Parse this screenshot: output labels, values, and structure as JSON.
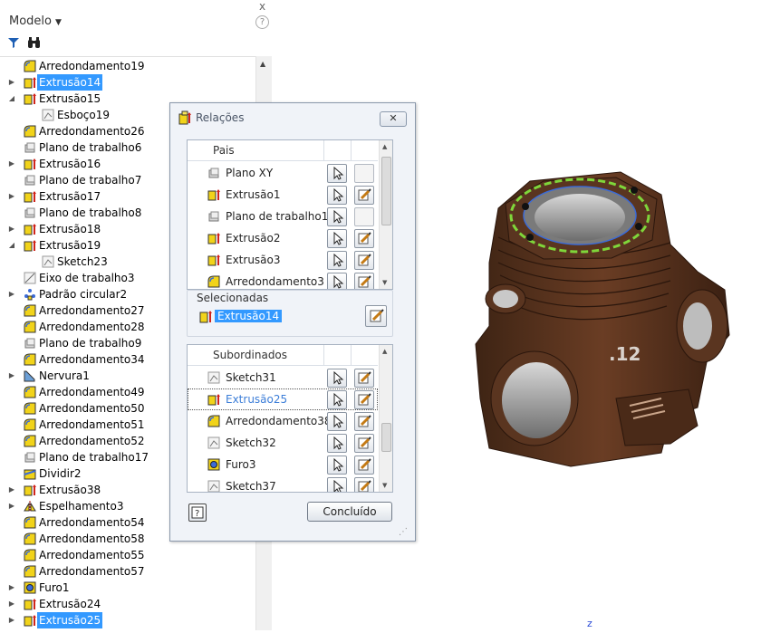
{
  "browser": {
    "title": "Modelo",
    "help": "?",
    "close": "x",
    "tree": [
      {
        "label": "Arredondamento19",
        "icon": "fillet-icon",
        "expand": "",
        "indent": 0,
        "selected": false
      },
      {
        "label": "Extrusão14",
        "icon": "extrusion-icon",
        "expand": "▶",
        "indent": 0,
        "selected": true
      },
      {
        "label": "Extrusão15",
        "icon": "extrusion-icon",
        "expand": "◢",
        "indent": 0,
        "selected": false
      },
      {
        "label": "Esboço19",
        "icon": "sketch-icon",
        "expand": "",
        "indent": 1,
        "selected": false
      },
      {
        "label": "Arredondamento26",
        "icon": "fillet-icon",
        "expand": "",
        "indent": 0,
        "selected": false
      },
      {
        "label": "Plano de trabalho6",
        "icon": "workplane-icon",
        "expand": "",
        "indent": 0,
        "selected": false
      },
      {
        "label": "Extrusão16",
        "icon": "extrusion-icon",
        "expand": "▶",
        "indent": 0,
        "selected": false
      },
      {
        "label": "Plano de trabalho7",
        "icon": "workplane-icon",
        "expand": "",
        "indent": 0,
        "selected": false
      },
      {
        "label": "Extrusão17",
        "icon": "extrusion-icon",
        "expand": "▶",
        "indent": 0,
        "selected": false
      },
      {
        "label": "Plano de trabalho8",
        "icon": "workplane-icon",
        "expand": "",
        "indent": 0,
        "selected": false
      },
      {
        "label": "Extrusão18",
        "icon": "extrusion-icon",
        "expand": "▶",
        "indent": 0,
        "selected": false
      },
      {
        "label": "Extrusão19",
        "icon": "extrusion-icon",
        "expand": "◢",
        "indent": 0,
        "selected": false
      },
      {
        "label": "Sketch23",
        "icon": "sketch-icon",
        "expand": "",
        "indent": 1,
        "selected": false
      },
      {
        "label": "Eixo de trabalho3",
        "icon": "workaxis-icon",
        "expand": "",
        "indent": 0,
        "selected": false
      },
      {
        "label": "Padrão circular2",
        "icon": "circular-pattern-icon",
        "expand": "▶",
        "indent": 0,
        "selected": false
      },
      {
        "label": "Arredondamento27",
        "icon": "fillet-icon",
        "expand": "",
        "indent": 0,
        "selected": false
      },
      {
        "label": "Arredondamento28",
        "icon": "fillet-icon",
        "expand": "",
        "indent": 0,
        "selected": false
      },
      {
        "label": "Plano de trabalho9",
        "icon": "workplane-icon",
        "expand": "",
        "indent": 0,
        "selected": false
      },
      {
        "label": "Arredondamento34",
        "icon": "fillet-icon",
        "expand": "",
        "indent": 0,
        "selected": false
      },
      {
        "label": "Nervura1",
        "icon": "rib-icon",
        "expand": "▶",
        "indent": 0,
        "selected": false
      },
      {
        "label": "Arredondamento49",
        "icon": "fillet-icon",
        "expand": "",
        "indent": 0,
        "selected": false
      },
      {
        "label": "Arredondamento50",
        "icon": "fillet-icon",
        "expand": "",
        "indent": 0,
        "selected": false
      },
      {
        "label": "Arredondamento51",
        "icon": "fillet-icon",
        "expand": "",
        "indent": 0,
        "selected": false
      },
      {
        "label": "Arredondamento52",
        "icon": "fillet-icon",
        "expand": "",
        "indent": 0,
        "selected": false
      },
      {
        "label": "Plano de trabalho17",
        "icon": "workplane-icon",
        "expand": "",
        "indent": 0,
        "selected": false
      },
      {
        "label": "Dividir2",
        "icon": "split-icon",
        "expand": "",
        "indent": 0,
        "selected": false
      },
      {
        "label": "Extrusão38",
        "icon": "extrusion-icon",
        "expand": "▶",
        "indent": 0,
        "selected": false
      },
      {
        "label": "Espelhamento3",
        "icon": "mirror-icon",
        "expand": "▶",
        "indent": 0,
        "selected": false
      },
      {
        "label": "Arredondamento54",
        "icon": "fillet-icon",
        "expand": "",
        "indent": 0,
        "selected": false
      },
      {
        "label": "Arredondamento58",
        "icon": "fillet-icon",
        "expand": "",
        "indent": 0,
        "selected": false
      },
      {
        "label": "Arredondamento55",
        "icon": "fillet-icon",
        "expand": "",
        "indent": 0,
        "selected": false
      },
      {
        "label": "Arredondamento57",
        "icon": "fillet-icon",
        "expand": "",
        "indent": 0,
        "selected": false
      },
      {
        "label": "Furo1",
        "icon": "hole-icon",
        "expand": "▶",
        "indent": 0,
        "selected": false
      },
      {
        "label": "Extrusão24",
        "icon": "extrusion-icon",
        "expand": "▶",
        "indent": 0,
        "selected": false
      },
      {
        "label": "Extrusão25",
        "icon": "extrusion-icon",
        "expand": "▶",
        "indent": 0,
        "selected": true
      }
    ]
  },
  "dialog": {
    "title": "Relações",
    "close": "✕",
    "parents": {
      "header": "Pais",
      "items": [
        {
          "label": "Plano XY",
          "icon": "workplane-icon",
          "edit": false
        },
        {
          "label": "Extrusão1",
          "icon": "extrusion-icon",
          "edit": true
        },
        {
          "label": "Plano de trabalho1",
          "icon": "workplane-icon",
          "edit": false
        },
        {
          "label": "Extrusão2",
          "icon": "extrusion-icon",
          "edit": true
        },
        {
          "label": "Extrusão3",
          "icon": "extrusion-icon",
          "edit": true
        },
        {
          "label": "Arredondamento3",
          "icon": "fillet-icon",
          "edit": true
        }
      ]
    },
    "selected": {
      "label": "Selecionadas",
      "value": "Extrusão14"
    },
    "children": {
      "header": "Subordinados",
      "items": [
        {
          "label": "Sketch31",
          "icon": "sketch-icon",
          "blue": false,
          "focus": false
        },
        {
          "label": "Extrusão25",
          "icon": "extrusion-icon",
          "blue": true,
          "focus": true
        },
        {
          "label": "Arredondamento38",
          "icon": "fillet-icon",
          "blue": false,
          "focus": false
        },
        {
          "label": "Sketch32",
          "icon": "sketch-icon",
          "blue": false,
          "focus": false
        },
        {
          "label": "Furo3",
          "icon": "hole-icon",
          "blue": false,
          "focus": false
        },
        {
          "label": "Sketch37",
          "icon": "sketch-icon",
          "blue": false,
          "focus": false
        }
      ]
    },
    "help": "?",
    "done": "Concluído"
  },
  "viewport": {
    "part_label": ".12",
    "axis": "z"
  },
  "colors": {
    "selection": "#3399ff",
    "part_body": "#4a2a18",
    "highlight": "#7fd63a"
  }
}
